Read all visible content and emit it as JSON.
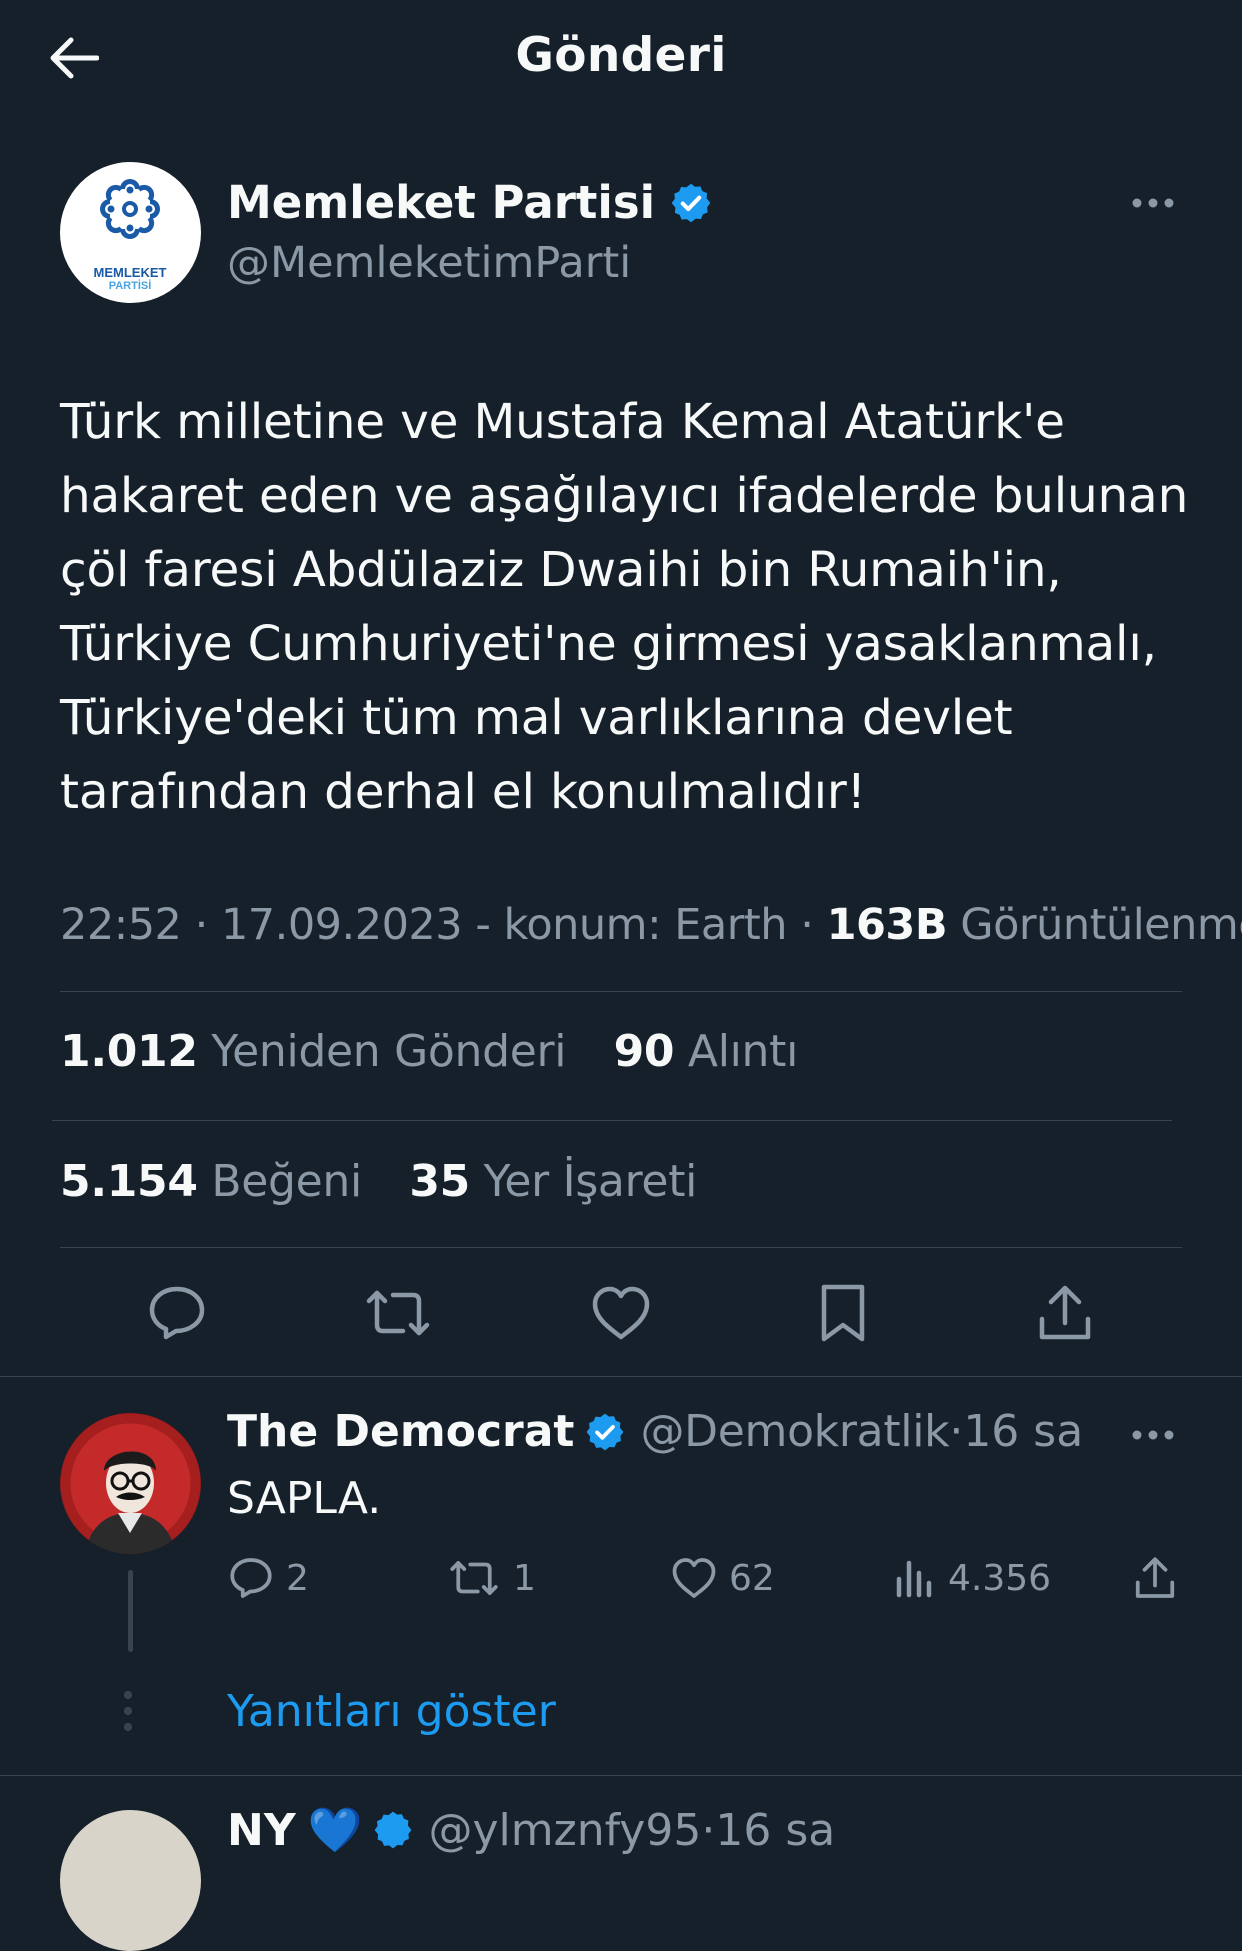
{
  "header": {
    "title": "Gönderi",
    "back_icon": "arrow-left-icon"
  },
  "main_tweet": {
    "author": {
      "name": "Memleket Partisi",
      "handle": "@MemleketimParti",
      "verified": true,
      "avatar_logo_line1": "MEMLEKET",
      "avatar_logo_line2": "PARTİSİ"
    },
    "text": "Türk milletine ve Mustafa Kemal Atatürk'e\nhakaret eden ve aşağılayıcı ifadelerde bulunan\nçöl faresi Abdülaziz Dwaihi bin Rumaih'in,\nTürkiye Cumhuriyeti'ne girmesi yasaklanmalı,\nTürkiye'deki tüm mal varlıklarına devlet\ntarafından derhal el konulmalıdır!",
    "meta": {
      "time": "22:52",
      "date": "17.09.2023",
      "location": "konum: Earth",
      "views_count": "163B",
      "views_label": "Görüntülenme"
    },
    "stats": {
      "reposts_count": "1.012",
      "reposts_label": "Yeniden Gönderi",
      "quotes_count": "90",
      "quotes_label": "Alıntı",
      "likes_count": "5.154",
      "likes_label": "Beğeni",
      "bookmarks_count": "35",
      "bookmarks_label": "Yer İşareti"
    }
  },
  "reply": {
    "name": "The Democrat",
    "handle": "@Demokratlik",
    "time": "16 sa",
    "verified": true,
    "text": "SAPLA.",
    "metrics": {
      "replies": "2",
      "reposts": "1",
      "likes": "62",
      "views": "4.356"
    },
    "show_replies_label": "Yanıtları göster"
  },
  "next_tweet": {
    "name": "NY",
    "emoji": "💙",
    "handle": "@ylmznfy95",
    "time": "16 sa"
  },
  "colors": {
    "background": "#15202b",
    "text_primary": "#f7f9f9",
    "text_secondary": "#8b98a5",
    "divider": "#38444d",
    "accent": "#1d9bf0"
  }
}
